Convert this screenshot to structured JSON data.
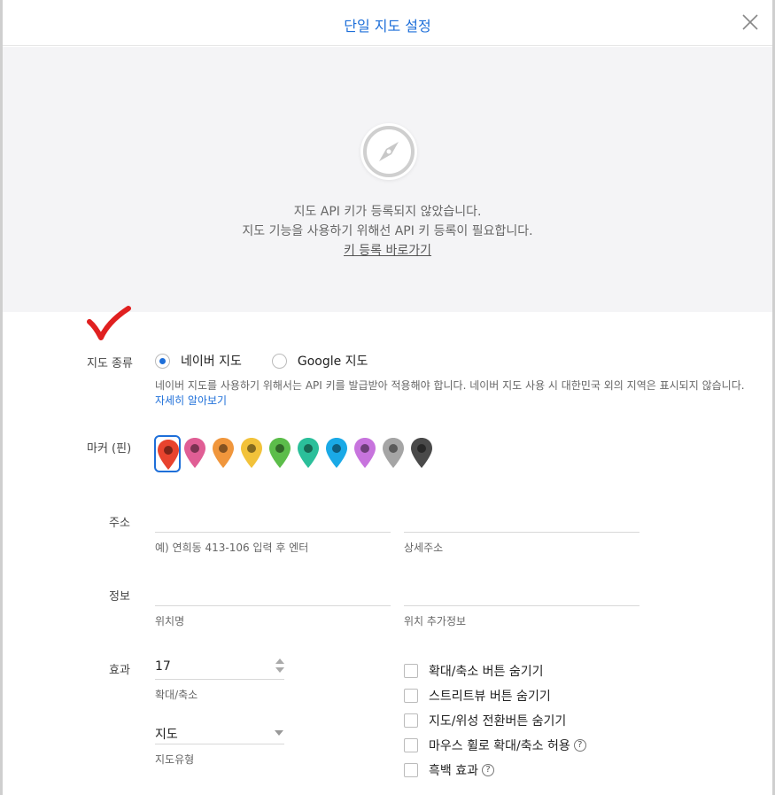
{
  "dialog": {
    "title": "단일 지도 설정"
  },
  "map_placeholder": {
    "message_line1": "지도 API 키가 등록되지 않았습니다.",
    "message_line2": "지도 기능을 사용하기 위해선 API 키 등록이 필요합니다.",
    "link_label": "키 등록 바로가기"
  },
  "map_type": {
    "label": "지도 종류",
    "options": [
      "네이버 지도",
      "Google 지도"
    ],
    "selected": "네이버 지도",
    "help_text": "네이버 지도를 사용하기 위해서는 API 키를 발급받아 적용해야 합니다. 네이버 지도 사용 시 대한민국 외의 지역은 표시되지 않습니다.",
    "help_link": "자세히 알아보기"
  },
  "marker": {
    "label": "마커 (핀)",
    "colors": [
      "#e8432e",
      "#e05e95",
      "#f0963c",
      "#f2c23a",
      "#5cbd4a",
      "#2bbf9a",
      "#1aa9e6",
      "#c774dd",
      "#a5a5a5",
      "#4a4a4a"
    ],
    "selected_index": 0
  },
  "address": {
    "label": "주소",
    "address_value": "",
    "address_caption": "예) 연희동 413-106 입력 후 엔터",
    "detail_value": "",
    "detail_caption": "상세주소"
  },
  "info": {
    "label": "정보",
    "name_value": "",
    "name_caption": "위치명",
    "extra_value": "",
    "extra_caption": "위치 추가정보"
  },
  "effects": {
    "label": "효과",
    "zoom_value": "17",
    "zoom_caption": "확대/축소",
    "map_type_value": "지도",
    "map_type_caption": "지도유형",
    "checkboxes": [
      "확대/축소 버튼 숨기기",
      "스트리트뷰 버튼 숨기기",
      "지도/위성 전환버튼 숨기기",
      "마우스 휠로 확대/축소 허용",
      "흑백 효과"
    ]
  },
  "colors": {
    "accent": "#1e6fd9",
    "map_bg": "#f4f4f6",
    "annotation_check": "#e02020"
  }
}
